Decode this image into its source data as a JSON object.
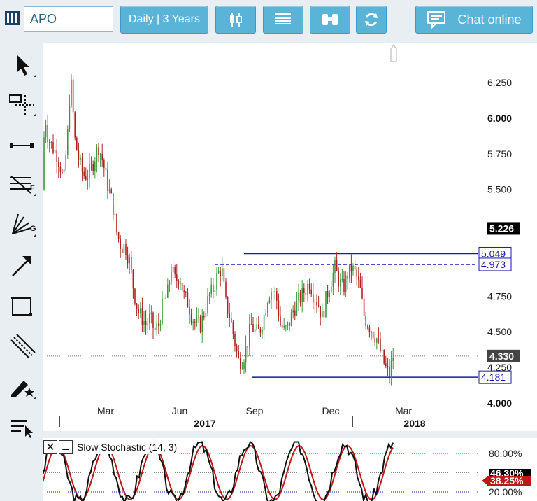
{
  "toolbar": {
    "symbol": "APO",
    "period_label": "Daily | 3 Years",
    "candle_icon": "candlestick-icon",
    "list_icon": "list-icon",
    "binoculars_icon": "binoculars-icon",
    "refresh_icon": "refresh-icon",
    "chat_label": "Chat online",
    "chat_icon": "chat-bubble-icon"
  },
  "tools": [
    {
      "name": "pointer-tool",
      "icon": "arrow-pointer-icon"
    },
    {
      "name": "crosshair-tool",
      "icon": "crosshair-icon"
    },
    {
      "name": "line-segment-tool",
      "icon": "line-segment-icon"
    },
    {
      "name": "fibonacci-tool",
      "icon": "fibonacci-icon",
      "letter": "F"
    },
    {
      "name": "gann-fan-tool",
      "icon": "gann-fan-icon",
      "letter": "G"
    },
    {
      "name": "arrow-tool",
      "icon": "diagonal-arrow-icon"
    },
    {
      "name": "rectangle-tool",
      "icon": "rectangle-icon"
    },
    {
      "name": "channel-tool",
      "icon": "parallel-channel-icon"
    },
    {
      "name": "annotate-tool",
      "icon": "pen-star-icon"
    },
    {
      "name": "indicator-menu-tool",
      "icon": "list-menu-icon"
    }
  ],
  "chart_data": {
    "type": "candlestick",
    "y_ticks": [
      "6.250",
      "6.000",
      "5.750",
      "5.500",
      "4.750",
      "4.500",
      "4.250",
      "4.000"
    ],
    "y_range": [
      4.0,
      6.5
    ],
    "x_months": [
      "Mar",
      "Jun",
      "Sep",
      "Dec",
      "Mar"
    ],
    "x_years": [
      "2017",
      "2018"
    ],
    "current_price": "5.226",
    "last_price": "4.330",
    "hline_labels": [
      "5.049",
      "4.973",
      "4.181"
    ],
    "hlines": [
      {
        "value": 5.049,
        "style": "solid",
        "color": "#1a1aaa"
      },
      {
        "value": 4.973,
        "style": "dashed",
        "color": "#1a1aaa"
      },
      {
        "value": 4.181,
        "style": "solid",
        "color": "#1a1aaa"
      }
    ],
    "last_value": 4.33,
    "up_color": "#3a9a3a",
    "down_color": "#b02020",
    "series_path": [
      [
        0,
        5.5
      ],
      [
        3,
        6.05
      ],
      [
        8,
        5.85
      ],
      [
        14,
        5.8
      ],
      [
        20,
        5.75
      ],
      [
        26,
        5.65
      ],
      [
        30,
        5.55
      ],
      [
        36,
        5.9
      ],
      [
        40,
        6.3
      ],
      [
        46,
        5.85
      ],
      [
        52,
        5.7
      ],
      [
        58,
        5.6
      ],
      [
        64,
        5.6
      ],
      [
        70,
        5.65
      ],
      [
        76,
        5.75
      ],
      [
        80,
        5.8
      ],
      [
        86,
        5.7
      ],
      [
        92,
        5.55
      ],
      [
        100,
        5.4
      ],
      [
        106,
        5.2
      ],
      [
        112,
        5.1
      ],
      [
        118,
        5.1
      ],
      [
        124,
        5.0
      ],
      [
        130,
        4.8
      ],
      [
        136,
        4.65
      ],
      [
        142,
        4.6
      ],
      [
        148,
        4.55
      ],
      [
        154,
        4.6
      ],
      [
        160,
        4.5
      ],
      [
        166,
        4.55
      ],
      [
        172,
        4.7
      ],
      [
        178,
        4.75
      ],
      [
        184,
        4.95
      ],
      [
        190,
        4.85
      ],
      [
        196,
        4.9
      ],
      [
        202,
        4.75
      ],
      [
        208,
        4.7
      ],
      [
        214,
        4.6
      ],
      [
        220,
        4.55
      ],
      [
        226,
        4.55
      ],
      [
        232,
        4.65
      ],
      [
        238,
        4.75
      ],
      [
        244,
        4.8
      ],
      [
        250,
        4.9
      ],
      [
        256,
        4.95
      ],
      [
        262,
        4.7
      ],
      [
        268,
        4.6
      ],
      [
        274,
        4.45
      ],
      [
        280,
        4.3
      ],
      [
        286,
        4.3
      ],
      [
        292,
        4.4
      ],
      [
        298,
        4.55
      ],
      [
        304,
        4.5
      ],
      [
        310,
        4.5
      ],
      [
        316,
        4.6
      ],
      [
        322,
        4.75
      ],
      [
        328,
        4.8
      ],
      [
        334,
        4.75
      ],
      [
        340,
        4.55
      ],
      [
        346,
        4.5
      ],
      [
        352,
        4.55
      ],
      [
        358,
        4.65
      ],
      [
        364,
        4.7
      ],
      [
        370,
        4.75
      ],
      [
        376,
        4.8
      ],
      [
        382,
        4.85
      ],
      [
        388,
        4.75
      ],
      [
        394,
        4.7
      ],
      [
        400,
        4.6
      ],
      [
        406,
        4.75
      ],
      [
        412,
        4.85
      ],
      [
        418,
        4.95
      ],
      [
        424,
        4.85
      ],
      [
        430,
        4.8
      ],
      [
        436,
        4.9
      ],
      [
        442,
        4.95
      ],
      [
        448,
        4.9
      ],
      [
        454,
        4.8
      ],
      [
        460,
        4.6
      ],
      [
        466,
        4.55
      ],
      [
        472,
        4.5
      ],
      [
        478,
        4.45
      ],
      [
        484,
        4.35
      ],
      [
        490,
        4.25
      ],
      [
        496,
        4.2
      ],
      [
        502,
        4.35
      ]
    ],
    "stochastic": {
      "label": "Slow Stochastic (14, 3)",
      "levels": [
        "80.00%",
        "20.00%"
      ],
      "value_k": "38.25%",
      "value_d": "46.30%"
    }
  }
}
